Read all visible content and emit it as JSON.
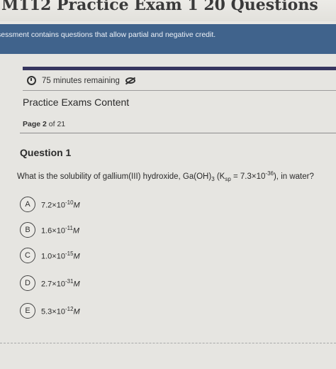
{
  "header": {
    "title": "M112 Practice Exam 1 20 Questions"
  },
  "notice": {
    "text": "sessment contains questions that allow partial and negative credit."
  },
  "timer": {
    "text": "75 minutes remaining"
  },
  "content": {
    "section_title": "Practice Exams Content",
    "page_label": "Page",
    "page_current": "2",
    "page_of": "of 21"
  },
  "question": {
    "title": "Question 1",
    "text_prefix": "What is the solubility of gallium(III) hydroxide, Ga(OH)",
    "text_sub1": "3",
    "text_mid": " (K",
    "text_sub2": "sp",
    "text_mid2": " = 7.3×10",
    "text_sup": "-36",
    "text_suffix": "), in water?",
    "options": [
      {
        "letter": "A",
        "mantissa": "7.2×10",
        "exp": "-10",
        "unit": "M"
      },
      {
        "letter": "B",
        "mantissa": "1.6×10",
        "exp": "-11",
        "unit": "M"
      },
      {
        "letter": "C",
        "mantissa": "1.0×10",
        "exp": "-15",
        "unit": "M"
      },
      {
        "letter": "D",
        "mantissa": "2.7×10",
        "exp": "-31",
        "unit": "M"
      },
      {
        "letter": "E",
        "mantissa": "5.3×10",
        "exp": "-12",
        "unit": "M"
      }
    ]
  }
}
